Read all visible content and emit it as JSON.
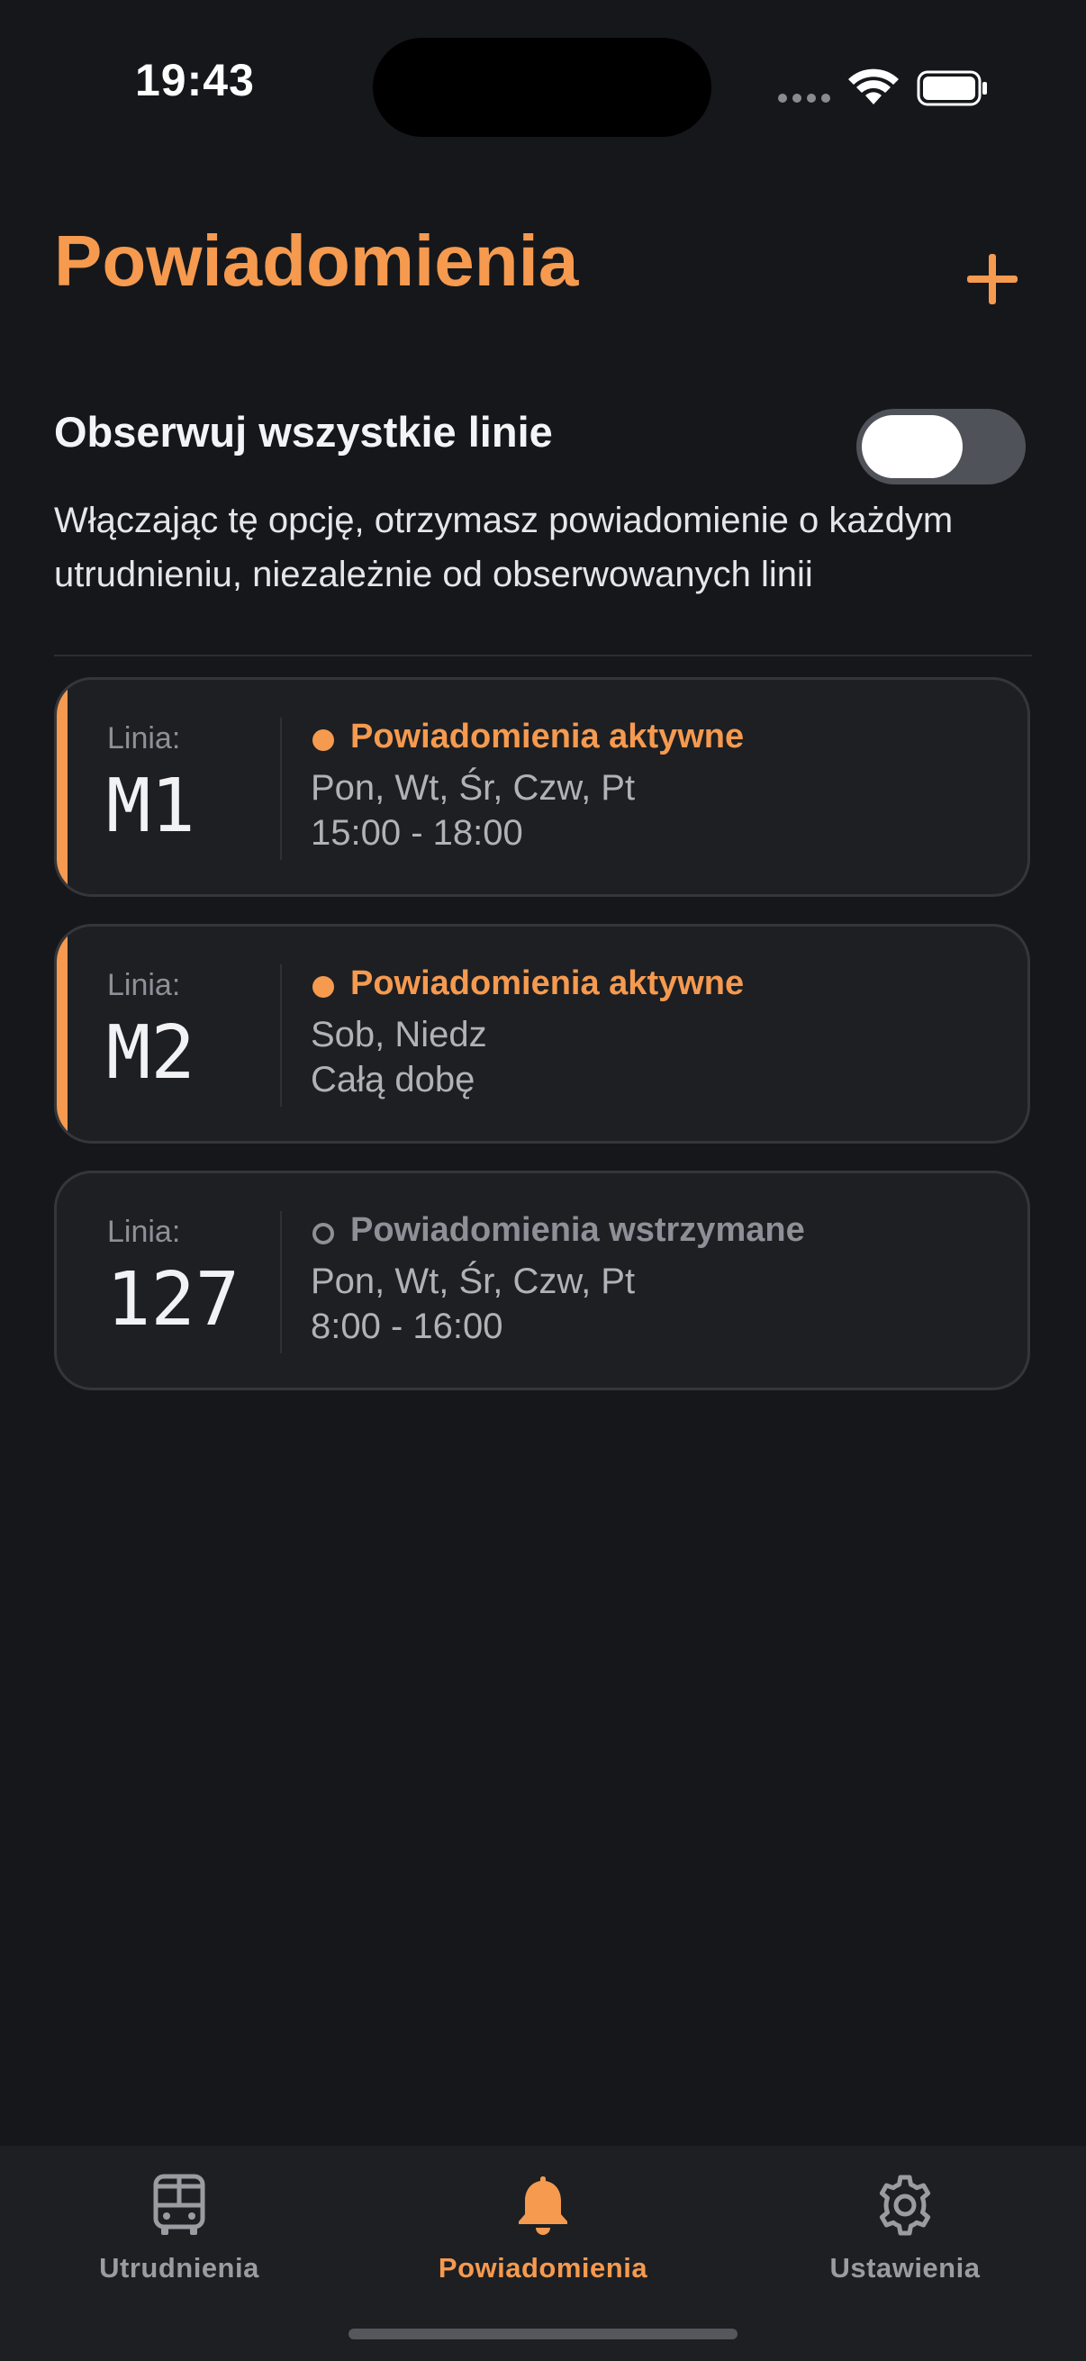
{
  "status_bar": {
    "time": "19:43"
  },
  "header": {
    "title": "Powiadomienia",
    "add_icon": "plus-icon",
    "accent_color": "#f59a4f"
  },
  "observe_all": {
    "label": "Obserwuj wszystkie linie",
    "toggle_on": false,
    "description": "Włączając tę opcję, otrzymasz powiadomienie o każdym utrudnieniu, niezależnie od obserwowanych linii"
  },
  "subscriptions": [
    {
      "linia_label": "Linia:",
      "line": "M1",
      "active": true,
      "status": "Powiadomienia aktywne",
      "days": "Pon, Wt, Śr, Czw, Pt",
      "hours": "15:00 - 18:00"
    },
    {
      "linia_label": "Linia:",
      "line": "M2",
      "active": true,
      "status": "Powiadomienia aktywne",
      "days": "Sob, Niedz",
      "hours": "Całą dobę"
    },
    {
      "linia_label": "Linia:",
      "line": "127",
      "active": false,
      "status": "Powiadomienia wstrzymane",
      "days": "Pon, Wt, Śr, Czw, Pt",
      "hours": "8:00 - 16:00"
    }
  ],
  "tabbar": {
    "tabs": [
      {
        "label": "Utrudnienia",
        "icon": "bus-icon",
        "selected": false
      },
      {
        "label": "Powiadomienia",
        "icon": "bell-icon",
        "selected": true
      },
      {
        "label": "Ustawienia",
        "icon": "gear-icon",
        "selected": false
      }
    ]
  }
}
